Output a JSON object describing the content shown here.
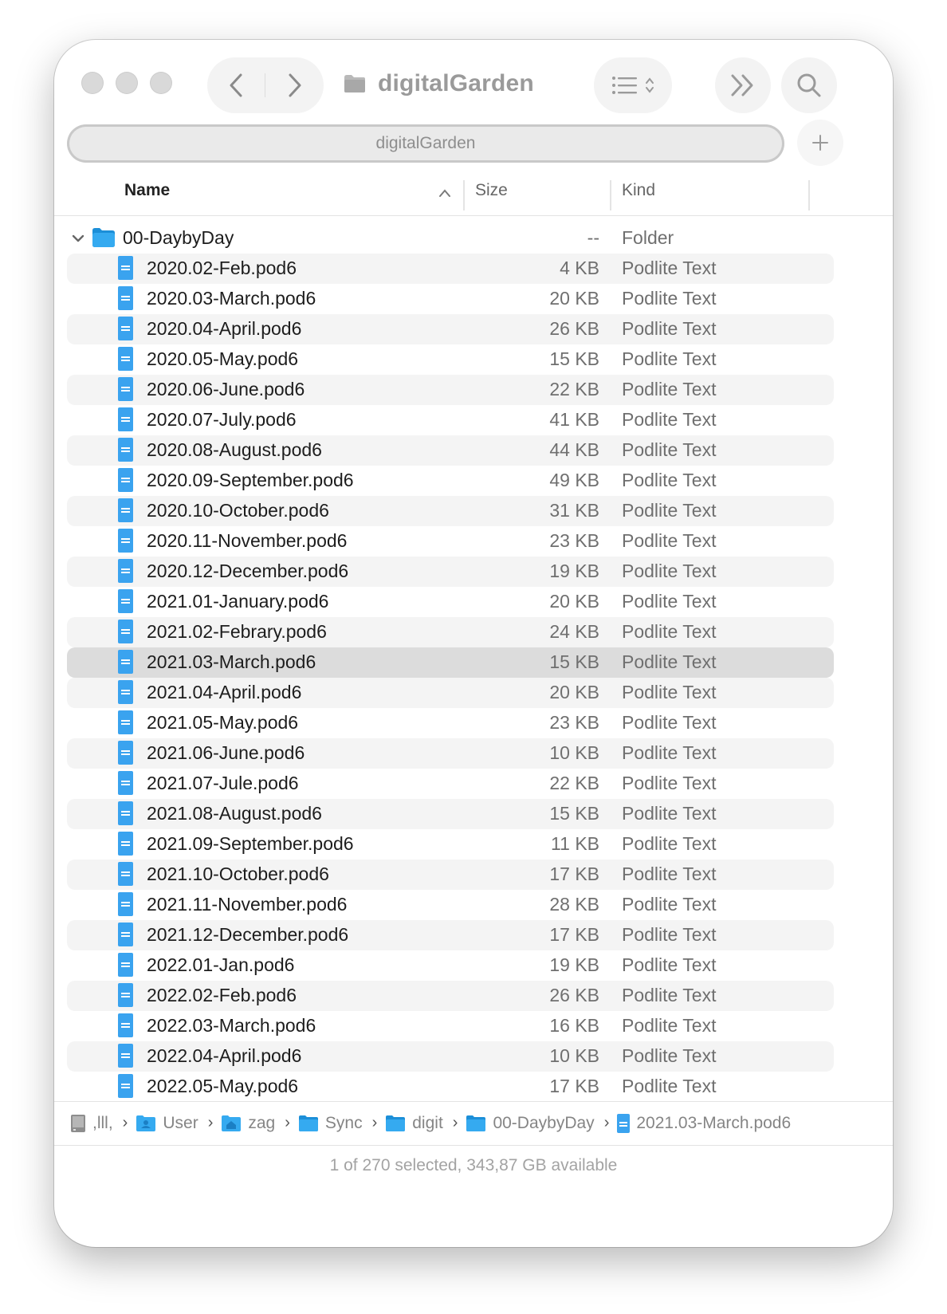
{
  "window": {
    "title": "digitalGarden"
  },
  "tabbar": {
    "tab_label": "digitalGarden"
  },
  "columns": {
    "name": "Name",
    "size": "Size",
    "kind": "Kind"
  },
  "folder": {
    "name": "00-DaybyDay",
    "size": "--",
    "kind": "Folder"
  },
  "files": [
    {
      "name": "2020.02-Feb.pod6",
      "size": "4 KB",
      "kind": "Podlite Text"
    },
    {
      "name": "2020.03-March.pod6",
      "size": "20 KB",
      "kind": "Podlite Text"
    },
    {
      "name": "2020.04-April.pod6",
      "size": "26 KB",
      "kind": "Podlite Text"
    },
    {
      "name": "2020.05-May.pod6",
      "size": "15 KB",
      "kind": "Podlite Text"
    },
    {
      "name": "2020.06-June.pod6",
      "size": "22 KB",
      "kind": "Podlite Text"
    },
    {
      "name": "2020.07-July.pod6",
      "size": "41 KB",
      "kind": "Podlite Text"
    },
    {
      "name": "2020.08-August.pod6",
      "size": "44 KB",
      "kind": "Podlite Text"
    },
    {
      "name": "2020.09-September.pod6",
      "size": "49 KB",
      "kind": "Podlite Text"
    },
    {
      "name": "2020.10-October.pod6",
      "size": "31 KB",
      "kind": "Podlite Text"
    },
    {
      "name": "2020.11-November.pod6",
      "size": "23 KB",
      "kind": "Podlite Text"
    },
    {
      "name": "2020.12-December.pod6",
      "size": "19 KB",
      "kind": "Podlite Text"
    },
    {
      "name": "2021.01-January.pod6",
      "size": "20 KB",
      "kind": "Podlite Text"
    },
    {
      "name": "2021.02-Febrary.pod6",
      "size": "24 KB",
      "kind": "Podlite Text"
    },
    {
      "name": "2021.03-March.pod6",
      "size": "15 KB",
      "kind": "Podlite Text",
      "selected": true
    },
    {
      "name": "2021.04-April.pod6",
      "size": "20 KB",
      "kind": "Podlite Text"
    },
    {
      "name": "2021.05-May.pod6",
      "size": "23 KB",
      "kind": "Podlite Text"
    },
    {
      "name": "2021.06-June.pod6",
      "size": "10 KB",
      "kind": "Podlite Text"
    },
    {
      "name": "2021.07-Jule.pod6",
      "size": "22 KB",
      "kind": "Podlite Text"
    },
    {
      "name": "2021.08-August.pod6",
      "size": "15 KB",
      "kind": "Podlite Text"
    },
    {
      "name": "2021.09-September.pod6",
      "size": "11 KB",
      "kind": "Podlite Text"
    },
    {
      "name": "2021.10-October.pod6",
      "size": "17 KB",
      "kind": "Podlite Text"
    },
    {
      "name": "2021.11-November.pod6",
      "size": "28 KB",
      "kind": "Podlite Text"
    },
    {
      "name": "2021.12-December.pod6",
      "size": "17 KB",
      "kind": "Podlite Text"
    },
    {
      "name": "2022.01-Jan.pod6",
      "size": "19 KB",
      "kind": "Podlite Text"
    },
    {
      "name": "2022.02-Feb.pod6",
      "size": "26 KB",
      "kind": "Podlite Text"
    },
    {
      "name": "2022.03-March.pod6",
      "size": "16 KB",
      "kind": "Podlite Text"
    },
    {
      "name": "2022.04-April.pod6",
      "size": "10 KB",
      "kind": "Podlite Text"
    },
    {
      "name": "2022.05-May.pod6",
      "size": "17 KB",
      "kind": "Podlite Text"
    }
  ],
  "pathbar": [
    {
      "label": ",lll,",
      "icon": "disk-icon"
    },
    {
      "label": "User",
      "icon": "users-folder-icon"
    },
    {
      "label": "zag",
      "icon": "home-folder-icon"
    },
    {
      "label": "Sync",
      "icon": "folder-icon"
    },
    {
      "label": "digit",
      "icon": "folder-icon"
    },
    {
      "label": "00-DaybyDay",
      "icon": "folder-icon"
    },
    {
      "label": "2021.03-March.pod6",
      "icon": "document-icon"
    }
  ],
  "status": {
    "text": "1 of 270 selected, 343,87 GB available"
  },
  "colors": {
    "accent_folder": "#2fa8ec",
    "doc_icon": "#3aa3ef",
    "selected_row": "#dcdcdc",
    "alt_row": "#f4f4f4"
  }
}
